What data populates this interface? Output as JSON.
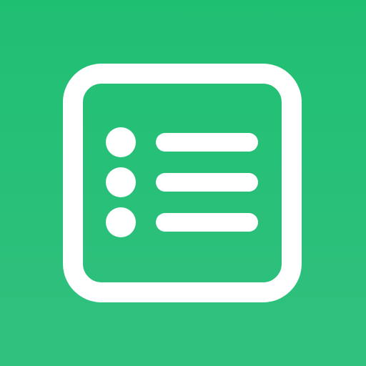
{
  "icon": {
    "name": "list-icon",
    "background_top": "#1fbf72",
    "background_bottom": "#31c17f",
    "foreground": "#ffffff",
    "item_count": 3
  }
}
